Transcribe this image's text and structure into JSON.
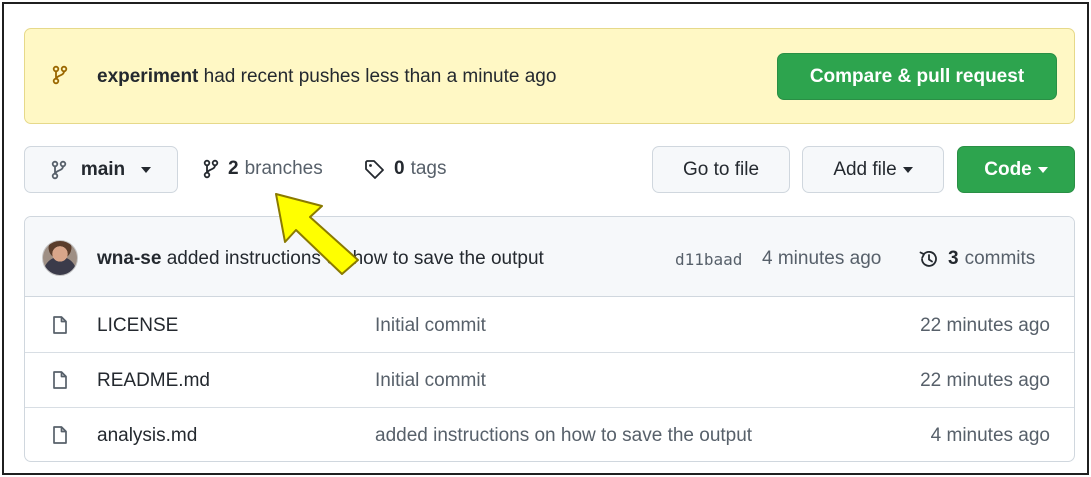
{
  "banner": {
    "branch_name": "experiment",
    "message": " had recent pushes less than a minute ago",
    "compare_button": "Compare & pull request"
  },
  "toolbar": {
    "current_branch": "main",
    "branches_count": "2",
    "branches_label": "branches",
    "tags_count": "0",
    "tags_label": "tags",
    "go_to_file": "Go to file",
    "add_file": "Add file",
    "code": "Code"
  },
  "latest_commit": {
    "author": "wna-se",
    "message": " added instructions on how to save the output",
    "sha": "d11baad",
    "age": "4 minutes ago",
    "commits_count": "3",
    "commits_label": "commits"
  },
  "files": [
    {
      "name": "LICENSE",
      "commit": "Initial commit",
      "age": "22 minutes ago"
    },
    {
      "name": "README.md",
      "commit": "Initial commit",
      "age": "22 minutes ago"
    },
    {
      "name": "analysis.md",
      "commit": "added instructions on how to save the output",
      "age": "4 minutes ago"
    }
  ],
  "colors": {
    "banner_bg": "#fff8c5",
    "primary_green": "#2da44e",
    "arrow_yellow": "#ffff00",
    "branch_icon": "#9a6700"
  },
  "icons": {
    "banner": "git-branch-icon",
    "branches": "git-branch-icon",
    "tags": "tag-icon",
    "history": "history-icon",
    "file": "file-icon"
  }
}
